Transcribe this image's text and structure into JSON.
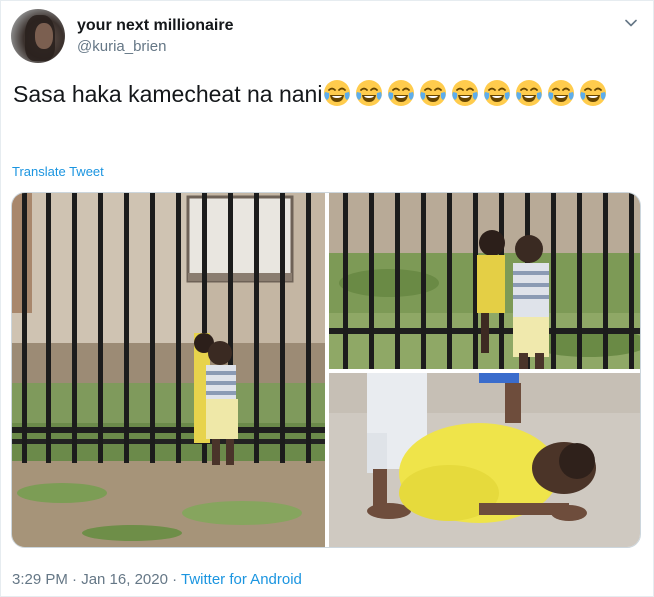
{
  "author": {
    "display_name": "your next millionaire",
    "handle": "@kuria_brien"
  },
  "icons": {
    "menu": "chevron-down-icon",
    "emoji": "face-with-tears-of-joy"
  },
  "tweet": {
    "text": "Sasa haka kamecheat na nani",
    "emoji_count": 9
  },
  "translate_label": "Translate Tweet",
  "timestamp": "3:29 PM · Jan 16, 2020 · ",
  "source": "Twitter for Android",
  "colors": {
    "link": "#1b95e0",
    "secondary_text": "#657786",
    "primary_text": "#14171a"
  }
}
